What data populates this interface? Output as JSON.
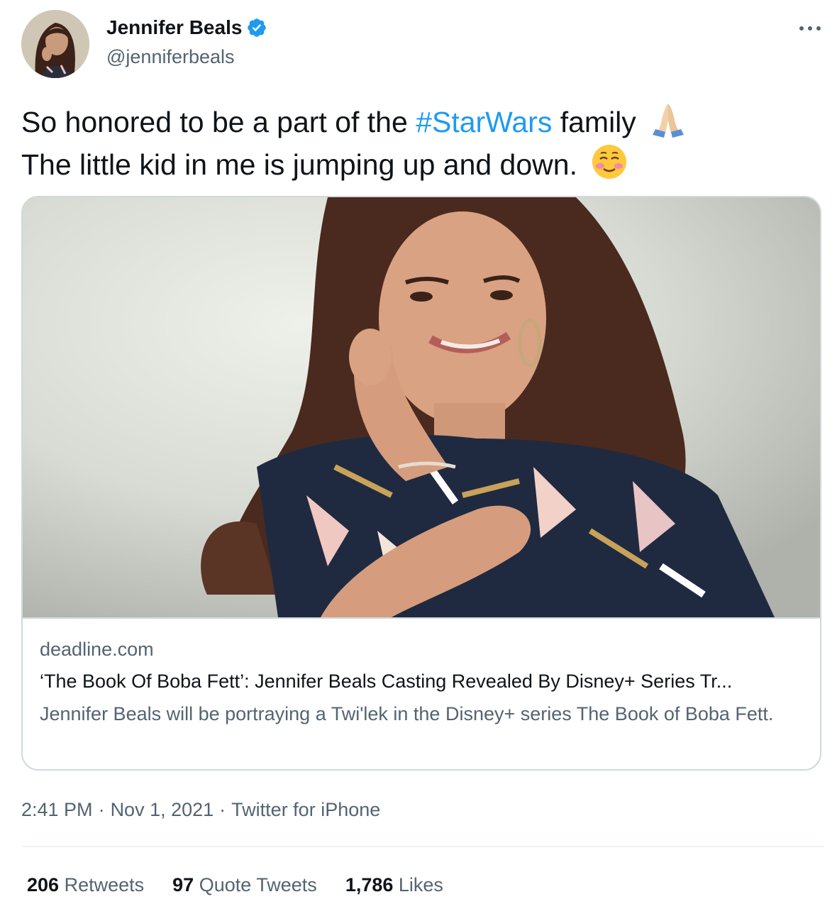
{
  "author": {
    "display_name": "Jennifer Beals",
    "handle": "@jenniferbeals",
    "verified": true,
    "avatar_icon": "profile-photo"
  },
  "tweet": {
    "text_part1": "So honored to be a part of the ",
    "hashtag": "#StarWars",
    "text_part2": " family ",
    "emoji1": "folded-hands-emoji",
    "line2": "The little kid in me is jumping up and down. ",
    "emoji2": "smiling-face-emoji"
  },
  "card": {
    "image_icon": "article-photo",
    "domain": "deadline.com",
    "title": "‘The Book Of Boba Fett’: Jennifer Beals Casting Revealed By Disney+ Series Tr...",
    "description": "Jennifer Beals will be portraying a Twi'lek in the Disney+ series The Book of Boba Fett."
  },
  "meta": {
    "time": "2:41 PM",
    "separator": "·",
    "date": "Nov 1, 2021",
    "source": "Twitter for iPhone"
  },
  "stats": {
    "retweets_count": "206",
    "retweets_label": "Retweets",
    "quotes_count": "97",
    "quotes_label": "Quote Tweets",
    "likes_count": "1,786",
    "likes_label": "Likes"
  },
  "colors": {
    "accent": "#1d9bf0",
    "secondary_text": "#536471",
    "border": "#cfd9de"
  }
}
